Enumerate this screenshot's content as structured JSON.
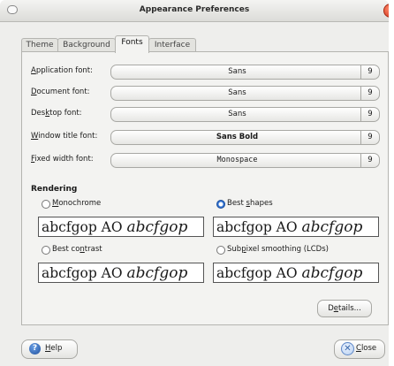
{
  "window": {
    "title": "Appearance Preferences"
  },
  "tabs": [
    {
      "label": "Theme"
    },
    {
      "label": "Background"
    },
    {
      "label": "Fonts"
    },
    {
      "label": "Interface"
    }
  ],
  "fonts": [
    {
      "label_pre": "",
      "label_u": "A",
      "label_post": "pplication font:",
      "font": "Sans",
      "size": "9"
    },
    {
      "label_pre": "",
      "label_u": "D",
      "label_post": "ocument font:",
      "font": "Sans",
      "size": "9"
    },
    {
      "label_pre": "Des",
      "label_u": "k",
      "label_post": "top font:",
      "font": "Sans",
      "size": "9"
    },
    {
      "label_pre": "",
      "label_u": "W",
      "label_post": "indow title font:",
      "font": "Sans Bold",
      "size": "9"
    },
    {
      "label_pre": "",
      "label_u": "F",
      "label_post": "ixed width font:",
      "font": "Monospace",
      "size": "9"
    }
  ],
  "rendering": {
    "title": "Rendering",
    "options": [
      {
        "pre": "",
        "u": "M",
        "post": "onochrome",
        "selected": false,
        "sample_plain": "abcfgop AO ",
        "sample_italic": "abcfgop"
      },
      {
        "pre": "Best ",
        "u": "s",
        "post": "hapes",
        "selected": true,
        "sample_plain": "abcfgop AO ",
        "sample_italic": "abcfgop"
      },
      {
        "pre": "Best co",
        "u": "n",
        "post": "trast",
        "selected": false,
        "sample_plain": "abcfgop AO ",
        "sample_italic": "abcfgop"
      },
      {
        "pre": "Sub",
        "u": "p",
        "post": "ixel smoothing (LCDs)",
        "selected": false,
        "sample_plain": "abcfgop AO ",
        "sample_italic": "abcfgop"
      }
    ]
  },
  "buttons": {
    "details_pre": "D",
    "details_u": "e",
    "details_post": "tails...",
    "help_u": "H",
    "help_post": "elp",
    "close_u": "C",
    "close_post": "lose"
  },
  "icons": {
    "help": "?",
    "close": "✕"
  }
}
